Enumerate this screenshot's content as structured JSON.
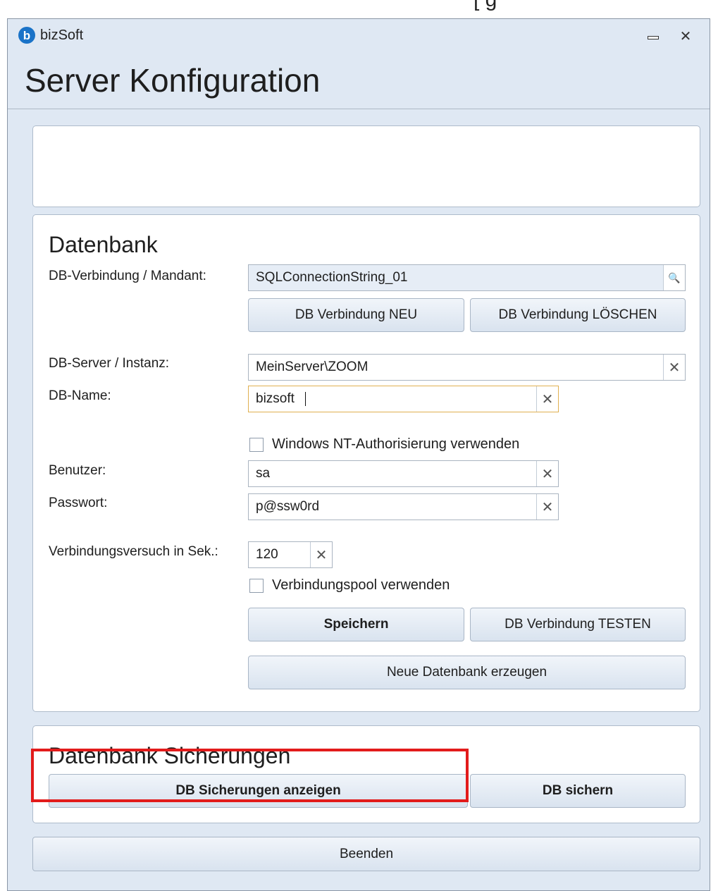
{
  "top_text": "[        g",
  "window": {
    "app_title": "bizSoft",
    "app_icon": "b",
    "minimize_icon": "minimize-icon",
    "close_icon": "close-icon",
    "close_glyph": "✕"
  },
  "page_title": "Server Konfiguration",
  "datenbank": {
    "title": "Datenbank",
    "connection_label": "DB-Verbindung / Mandant:",
    "connection_value": "SQLConnectionString_01",
    "search_glyph": "🔍",
    "btn_new": "DB Verbindung NEU",
    "btn_delete": "DB Verbindung LÖSCHEN",
    "server_label": "DB-Server / Instanz:",
    "server_value": "MeinServer\\ZOOM",
    "name_label": "DB-Name:",
    "name_value": "bizsoft",
    "nt_auth_label": "Windows NT-Authorisierung verwenden",
    "user_label": "Benutzer:",
    "user_value": "sa",
    "password_label": "Passwort:",
    "password_value": "p@ssw0rd",
    "timeout_label": "Verbindungsversuch in Sek.:",
    "timeout_value": "120",
    "pool_label": "Verbindungspool verwenden",
    "btn_save": "Speichern",
    "btn_test": "DB Verbindung TESTEN",
    "btn_create": "Neue Datenbank erzeugen",
    "clear_glyph": "✕"
  },
  "sicherungen": {
    "title": "Datenbank Sicherungen",
    "btn_show": "DB Sicherungen anzeigen",
    "btn_backup": "DB sichern"
  },
  "btn_exit": "Beenden",
  "colors": {
    "highlight": "#e21b1b",
    "window_bg": "#dfe8f3",
    "accent": "#1a73c8"
  }
}
